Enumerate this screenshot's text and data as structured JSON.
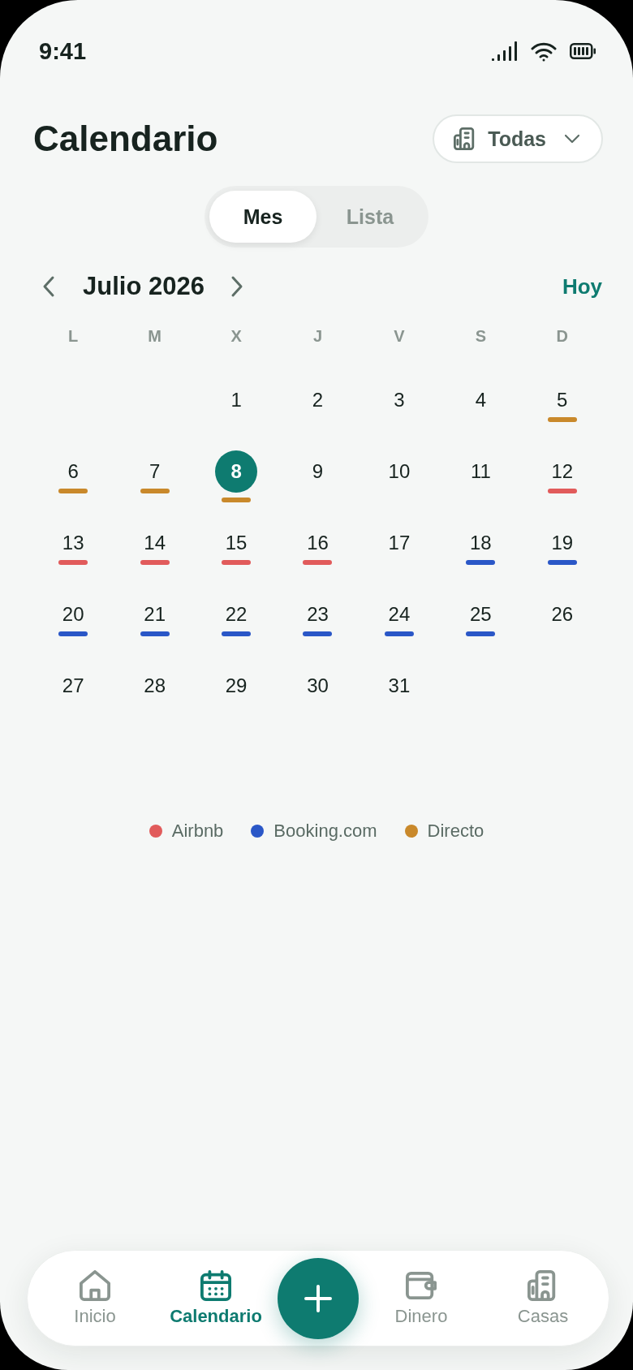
{
  "status_bar": {
    "time": "9:41"
  },
  "header": {
    "title": "Calendario",
    "property_filter": {
      "label": "Todas"
    }
  },
  "view_toggle": [
    {
      "label": "Mes",
      "selected": true
    },
    {
      "label": "Lista",
      "selected": false
    }
  ],
  "month_nav": {
    "month": "Julio 2026",
    "today_link": "Hoy"
  },
  "calendar": {
    "weekdays": [
      "L",
      "M",
      "X",
      "J",
      "V",
      "S",
      "D"
    ],
    "weeks": [
      [
        {
          "day": "1",
          "selected": false
        },
        {
          "day": "2",
          "selected": false
        },
        {
          "day": "3",
          "selected": false
        },
        {
          "day": "4",
          "selected": false
        },
        {
          "day": "5",
          "selected": false,
          "color": "#c9892b"
        }
      ],
      [
        {
          "day": "6",
          "selected": false,
          "color": "#c9892b"
        },
        {
          "day": "7",
          "selected": false,
          "color": "#c9892b"
        },
        {
          "day": "8",
          "selected": true,
          "color": "#c9892b"
        },
        {
          "day": "9",
          "selected": false
        },
        {
          "day": "10",
          "selected": false
        },
        {
          "day": "11",
          "selected": false
        },
        {
          "day": "12",
          "selected": false,
          "color": "#e15b5b"
        }
      ],
      [
        {
          "day": "13",
          "selected": false,
          "color": "#e15b5b"
        },
        {
          "day": "14",
          "selected": false,
          "color": "#e15b5b"
        },
        {
          "day": "15",
          "selected": false,
          "color": "#e15b5b"
        },
        {
          "day": "16",
          "selected": false,
          "color": "#e15b5b"
        },
        {
          "day": "17",
          "selected": false
        },
        {
          "day": "18",
          "selected": false,
          "color": "#2a57c7"
        },
        {
          "day": "19",
          "selected": false,
          "color": "#2a57c7"
        }
      ],
      [
        {
          "day": "20",
          "selected": false,
          "color": "#2a57c7"
        },
        {
          "day": "21",
          "selected": false,
          "color": "#2a57c7"
        },
        {
          "day": "22",
          "selected": false,
          "color": "#2a57c7"
        },
        {
          "day": "23",
          "selected": false,
          "color": "#2a57c7"
        },
        {
          "day": "24",
          "selected": false,
          "color": "#2a57c7"
        },
        {
          "day": "25",
          "selected": false,
          "color": "#2a57c7"
        },
        {
          "day": "26",
          "selected": false
        }
      ],
      [
        {
          "day": "27",
          "selected": false
        },
        {
          "day": "28",
          "selected": false
        },
        {
          "day": "29",
          "selected": false
        },
        {
          "day": "30",
          "selected": false
        },
        {
          "day": "31",
          "selected": false
        }
      ]
    ]
  },
  "legend": [
    {
      "label": "Airbnb",
      "color": "#e15b5b"
    },
    {
      "label": "Booking.com",
      "color": "#2a57c7"
    },
    {
      "label": "Directo",
      "color": "#c9892b"
    }
  ],
  "bottom_nav": [
    {
      "kind": "home",
      "label": "Inicio",
      "selected": false
    },
    {
      "kind": "calendar",
      "label": "Calendario",
      "selected": true
    },
    {
      "kind": "add"
    },
    {
      "kind": "wallet",
      "label": "Dinero",
      "selected": false
    },
    {
      "kind": "building",
      "label": "Casas",
      "selected": false
    }
  ]
}
